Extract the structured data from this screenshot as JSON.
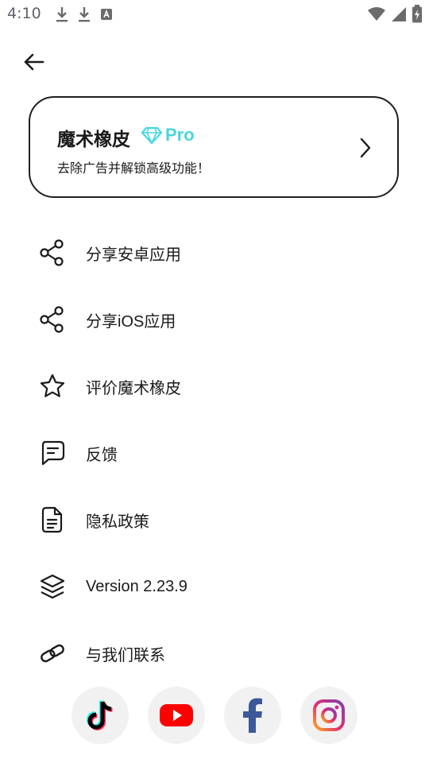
{
  "status_bar": {
    "time": "4:10",
    "left_icons": [
      "download-icon",
      "download-icon",
      "notification-a-icon"
    ],
    "right_icons": [
      "wifi-icon",
      "cell-signal-icon",
      "battery-charging-icon"
    ]
  },
  "header": {
    "back_icon": "arrow-left-icon"
  },
  "pro_card": {
    "title": "魔术橡皮",
    "badge_icon": "diamond-icon",
    "badge_label": "Pro",
    "subtitle": "去除广告并解锁高级功能！",
    "accent_color": "#4ad6dc"
  },
  "menu": {
    "items": [
      {
        "icon": "share-icon",
        "label": "分享安卓应用"
      },
      {
        "icon": "share-icon",
        "label": "分享iOS应用"
      },
      {
        "icon": "star-icon",
        "label": "评价魔术橡皮"
      },
      {
        "icon": "feedback-icon",
        "label": "反馈"
      },
      {
        "icon": "document-icon",
        "label": "隐私政策"
      },
      {
        "icon": "layers-icon",
        "label": "Version 2.23.9"
      },
      {
        "icon": "link-icon",
        "label": "与我们联系"
      }
    ]
  },
  "social": {
    "items": [
      {
        "icon": "tiktok-icon",
        "color": "#000000"
      },
      {
        "icon": "youtube-icon",
        "color": "#ff0000"
      },
      {
        "icon": "facebook-icon",
        "color": "#3b5998"
      },
      {
        "icon": "instagram-icon",
        "color": "#e1306c"
      }
    ]
  }
}
